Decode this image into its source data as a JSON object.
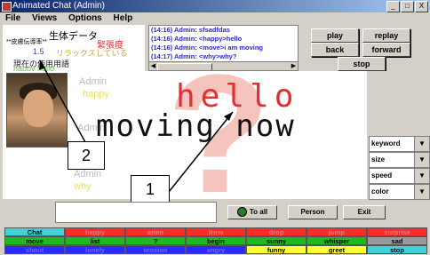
{
  "window": {
    "title": "Animated Chat (Admin)",
    "minimize": "_",
    "maximize": "□",
    "close": "X"
  },
  "menu": [
    "File",
    "Views",
    "Options",
    "Help"
  ],
  "chat_log": [
    "(14:16) Admin: sfsadfdas",
    "(14:16) Admin: <happy>hello",
    "(14:16) Admin: <move>i am moving",
    "(14:17) Admin: <why>why?"
  ],
  "controls": {
    "play": "play",
    "replay": "replay",
    "back": "back",
    "forward": "forward",
    "stop": "stop"
  },
  "info_panel": {
    "biometrics": "生体データ",
    "skin": "**皮膚伝導率**",
    "tension": "緊張度",
    "value": "1.5",
    "relax": "リラックスしている",
    "current": "現在の使用用語",
    "happy_hello": "happy hello"
  },
  "stage": {
    "hello": "hello",
    "moving": "moving now",
    "ghost_admin1": "Admin",
    "ghost_happy": "happy",
    "ghost_admin2": "Admin",
    "ghost_admin3": "Admin",
    "ghost_why": "why",
    "big_char": "?"
  },
  "annotations": {
    "label1": "1",
    "label2": "2"
  },
  "attributes": [
    {
      "label": "keyword",
      "arrow": "▼"
    },
    {
      "label": "size",
      "arrow": "▼"
    },
    {
      "label": "speed",
      "arrow": "▼"
    },
    {
      "label": "color",
      "arrow": "▼"
    }
  ],
  "bottom_buttons": {
    "to_all": "To all",
    "person": "Person",
    "exit": "Exit"
  },
  "emotion_grid": [
    {
      "label": "Chat",
      "bg": "#3fd3d3",
      "fg": "#000000"
    },
    {
      "label": "happy",
      "bg": "#ff2a2a",
      "fg": "#d08080"
    },
    {
      "label": "atten",
      "bg": "#ff2a2a",
      "fg": "#d08080"
    },
    {
      "label": "trem",
      "bg": "#ff2a2a",
      "fg": "#d08080"
    },
    {
      "label": "drop",
      "bg": "#ff2a2a",
      "fg": "#d08080"
    },
    {
      "label": "jump",
      "bg": "#ff2a2a",
      "fg": "#d08080"
    },
    {
      "label": "surprise",
      "bg": "#ff2a2a",
      "fg": "#d08080"
    },
    {
      "label": "move",
      "bg": "#1fb81f",
      "fg": "#000000"
    },
    {
      "label": "list",
      "bg": "#1fb81f",
      "fg": "#000000"
    },
    {
      "label": "?",
      "bg": "#1fb81f",
      "fg": "#000000"
    },
    {
      "label": "begin",
      "bg": "#1fb81f",
      "fg": "#000000"
    },
    {
      "label": "sunny",
      "bg": "#1fb81f",
      "fg": "#000000"
    },
    {
      "label": "whisper",
      "bg": "#1fb81f",
      "fg": "#000000"
    },
    {
      "label": "sad",
      "bg": "#9a9a9a",
      "fg": "#000000"
    },
    {
      "label": "shout",
      "bg": "#2a2aff",
      "fg": "#6a6aff"
    },
    {
      "label": "lonely",
      "bg": "#2a2aff",
      "fg": "#6a6aff"
    },
    {
      "label": "tension",
      "bg": "#2a2aff",
      "fg": "#6a6aff"
    },
    {
      "label": "angry",
      "bg": "#2a2aff",
      "fg": "#6a6aff"
    },
    {
      "label": "funny",
      "bg": "#ffff33",
      "fg": "#000000"
    },
    {
      "label": "greet",
      "bg": "#ffff33",
      "fg": "#000000"
    },
    {
      "label": "stop",
      "bg": "#3fd3d3",
      "fg": "#000000"
    }
  ]
}
